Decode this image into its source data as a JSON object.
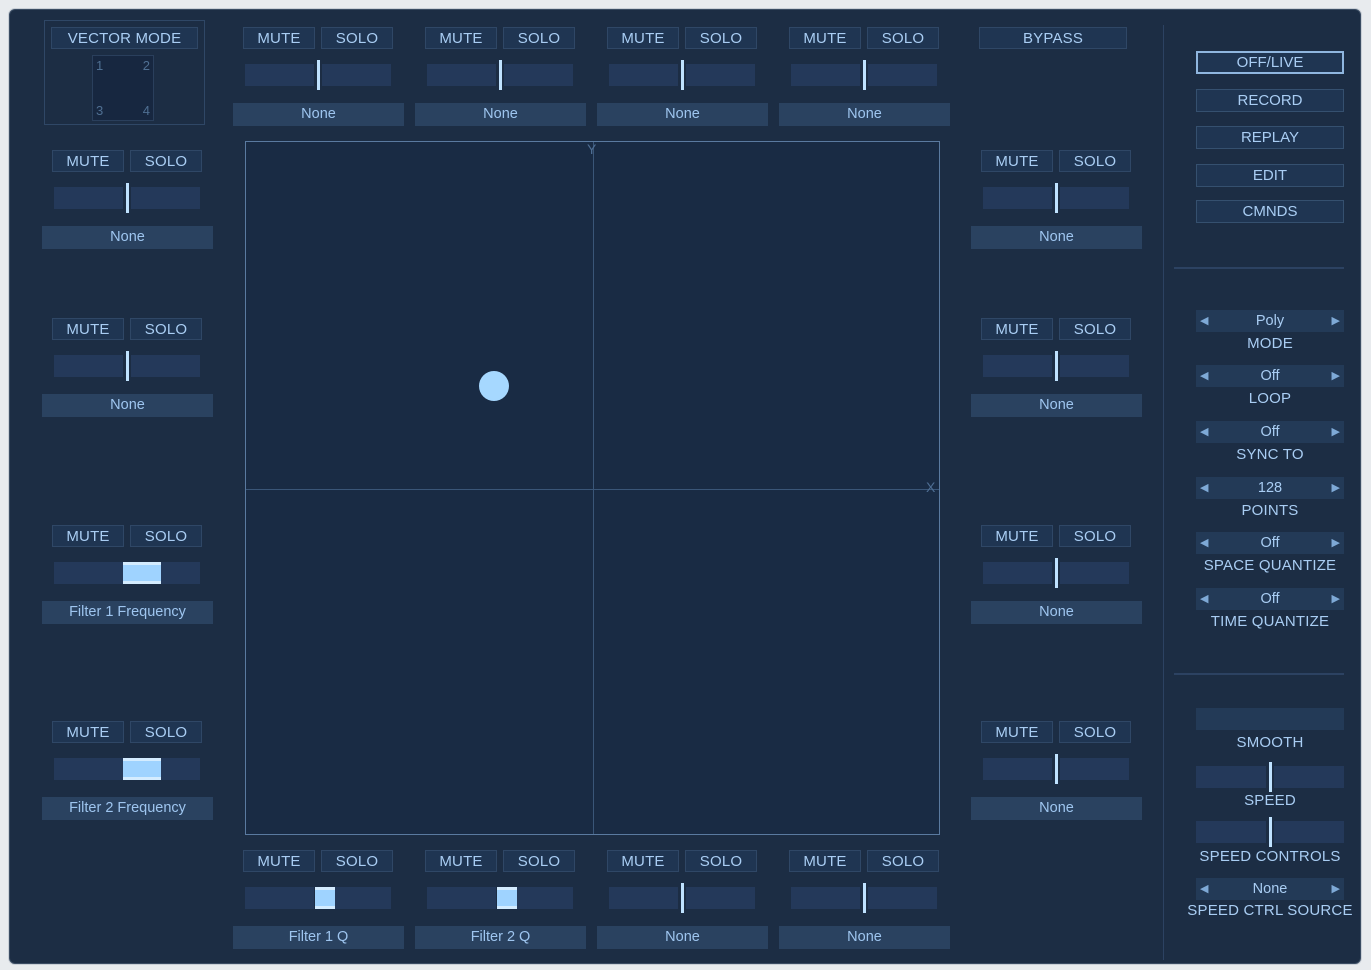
{
  "vector_mode": {
    "label": "VECTOR MODE",
    "pad": {
      "tl": "1",
      "tr": "2",
      "bl": "3",
      "br": "4"
    }
  },
  "bypass_label": "BYPASS",
  "xy_pad": {
    "x_label": "X",
    "y_label": "Y"
  },
  "channel_labels": {
    "mute": "MUTE",
    "solo": "SOLO"
  },
  "channels": {
    "top": [
      {
        "target": "None",
        "value": 0.5
      },
      {
        "target": "None",
        "value": 0.5
      },
      {
        "target": "None",
        "value": 0.5
      },
      {
        "target": "None",
        "value": 0.5
      }
    ],
    "bottom": [
      {
        "target": "Filter 1 Q",
        "value": 0.55
      },
      {
        "target": "Filter 2 Q",
        "value": 0.55
      },
      {
        "target": "None",
        "value": 0.5
      },
      {
        "target": "None",
        "value": 0.5
      }
    ],
    "left": [
      {
        "target": "None",
        "value": 0.5
      },
      {
        "target": "None",
        "value": 0.5
      },
      {
        "target": "Filter 1 Frequency",
        "value": 0.6
      },
      {
        "target": "Filter 2 Frequency",
        "value": 0.6
      }
    ],
    "right": [
      {
        "target": "None",
        "value": 0.5
      },
      {
        "target": "None",
        "value": 0.5
      },
      {
        "target": "None",
        "value": 0.5
      },
      {
        "target": "None",
        "value": 0.5
      }
    ]
  },
  "transport": {
    "off_live": "OFF/LIVE",
    "record": "RECORD",
    "replay": "REPLAY",
    "edit": "EDIT",
    "cmnds": "CMNDS"
  },
  "params": {
    "mode": {
      "value": "Poly",
      "label": "MODE"
    },
    "loop": {
      "value": "Off",
      "label": "LOOP"
    },
    "sync_to": {
      "value": "Off",
      "label": "SYNC TO"
    },
    "points": {
      "value": "128",
      "label": "POINTS"
    },
    "space_quantize": {
      "value": "Off",
      "label": "SPACE QUANTIZE"
    },
    "time_quantize": {
      "value": "Off",
      "label": "TIME QUANTIZE"
    }
  },
  "speed": {
    "smooth_label": "SMOOTH",
    "speed_label": "SPEED",
    "speed_value": 0.5,
    "controls_label": "SPEED CONTROLS",
    "controls_value": 0.5,
    "source_value": "None",
    "source_label": "SPEED CTRL SOURCE"
  },
  "colors": {
    "panel_bg": "#1c2d44",
    "accent": "#9fd3ff",
    "text": "#a9cdf3"
  }
}
